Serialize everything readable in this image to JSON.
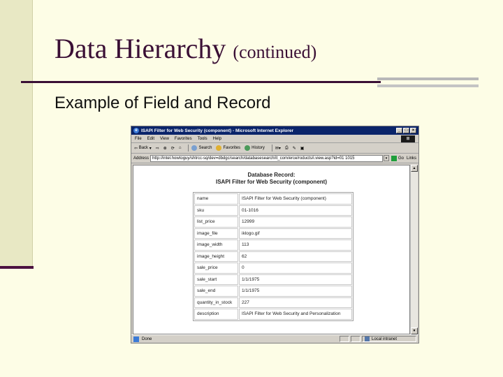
{
  "slide": {
    "title": "Data Hierarchy",
    "title_suffix": "(continued)",
    "subtitle": "Example of Field and Record"
  },
  "browser": {
    "window_title": "ISAPI Filter for Web Security (component) - Microsoft Internet Explorer",
    "window_buttons": [
      "_",
      "□",
      "×"
    ],
    "menu": [
      "File",
      "Edit",
      "View",
      "Favorites",
      "Tools",
      "Help"
    ],
    "toolbar": {
      "back": "Back",
      "search": "Search",
      "favorites": "Favorites",
      "history": "History"
    },
    "address": {
      "label": "Address",
      "url": "http://intel.howtoguy/shtrcc-sq/dev=dbdgc/search/databasesearch/it_com/erce/roducts/i.view.asp?id=01 1015",
      "go": "Go",
      "links": "Links"
    },
    "status": {
      "text": "Done",
      "zone": "Local intranet"
    }
  },
  "record": {
    "heading": "Database Record:",
    "name": "ISAPI Filter for Web Security (component)",
    "rows": [
      {
        "field": "name",
        "value": "ISAPI Filter for Web Security (component)"
      },
      {
        "field": "sku",
        "value": "01-1016"
      },
      {
        "field": "list_price",
        "value": "12999"
      },
      {
        "field": "image_file",
        "value": "iklogo.gif"
      },
      {
        "field": "image_width",
        "value": "113"
      },
      {
        "field": "image_height",
        "value": "62"
      },
      {
        "field": "sale_price",
        "value": "0"
      },
      {
        "field": "sale_start",
        "value": "1/1/1975"
      },
      {
        "field": "sale_end",
        "value": "1/1/1975"
      },
      {
        "field": "quantity_in_stock",
        "value": "227"
      },
      {
        "field": "description",
        "value": "ISAPI Filter for Web Security and Personalization"
      }
    ]
  },
  "colors": {
    "accent": "#3a0f35",
    "slide_background": "#fdfde6",
    "titlebar": "#0a246a"
  }
}
